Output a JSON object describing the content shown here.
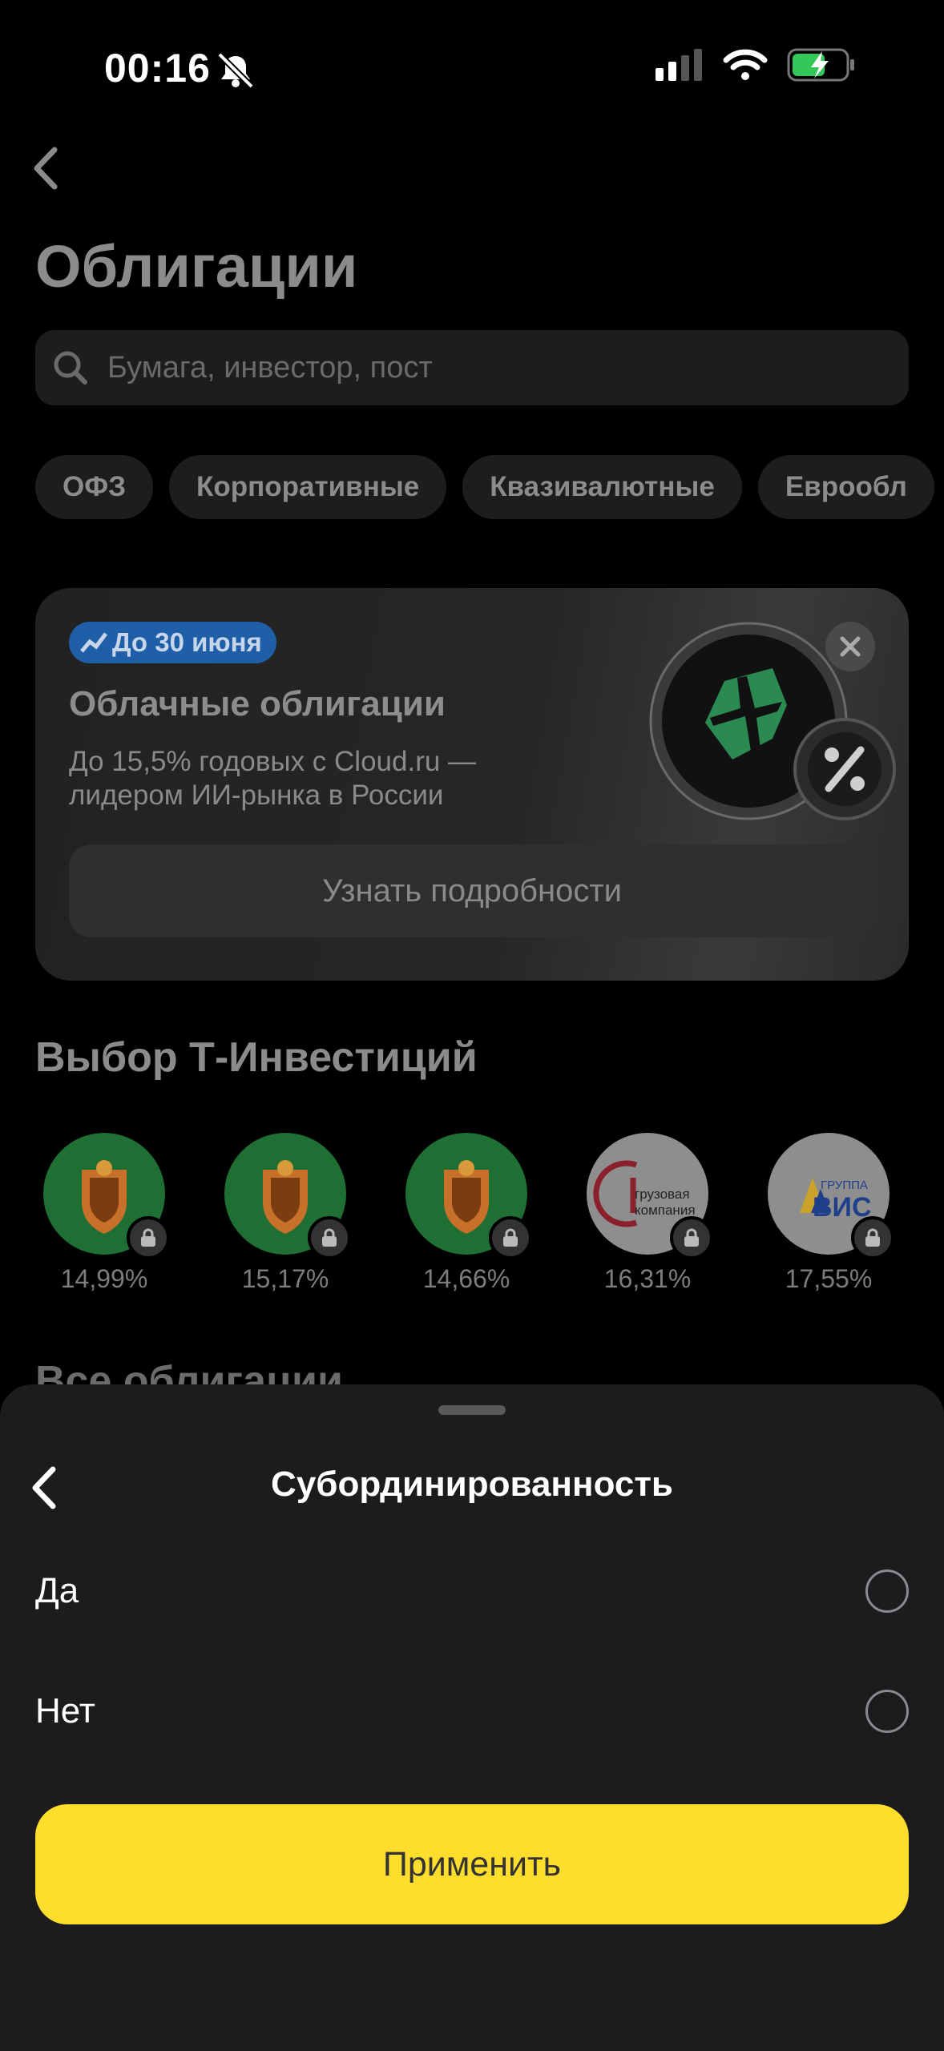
{
  "status_bar": {
    "time": "00:16"
  },
  "header": {
    "title": "Облигации",
    "search_placeholder": "Бумага, инвестор, пост"
  },
  "chips": [
    "ОФЗ",
    "Корпоративные",
    "Квазивалютные",
    "Еврообл"
  ],
  "promo": {
    "badge": "До 30 июня",
    "title": "Облачные облигации",
    "subtitle_line1": "До 15,5% годовых с Cloud.ru —",
    "subtitle_line2": "лидером ИИ-рынка в России",
    "button": "Узнать подробности"
  },
  "picks": {
    "title": "Выбор Т-Инвестиций",
    "items": [
      {
        "yield": "14,99%",
        "logo": "coat-of-arms-green"
      },
      {
        "yield": "15,17%",
        "logo": "coat-of-arms-green"
      },
      {
        "yield": "14,66%",
        "logo": "coat-of-arms-green"
      },
      {
        "yield": "16,31%",
        "logo": "pervaya-gruzovaya-kompaniya",
        "logo_text_1": "грузовая",
        "logo_text_2": "компания"
      },
      {
        "yield": "17,55%",
        "logo": "gruppa-vis",
        "logo_text_1": "ГРУППА",
        "logo_text_2": "ВИС"
      }
    ]
  },
  "peek_title": "Все облигации",
  "sheet": {
    "title": "Субординированность",
    "options": [
      {
        "label": "Да",
        "selected": false
      },
      {
        "label": "Нет",
        "selected": false
      }
    ],
    "apply": "Применить"
  },
  "colors": {
    "accent": "#ffdd2d",
    "sheet_bg": "#1c1c1e",
    "badge": "#1f5fa8"
  }
}
